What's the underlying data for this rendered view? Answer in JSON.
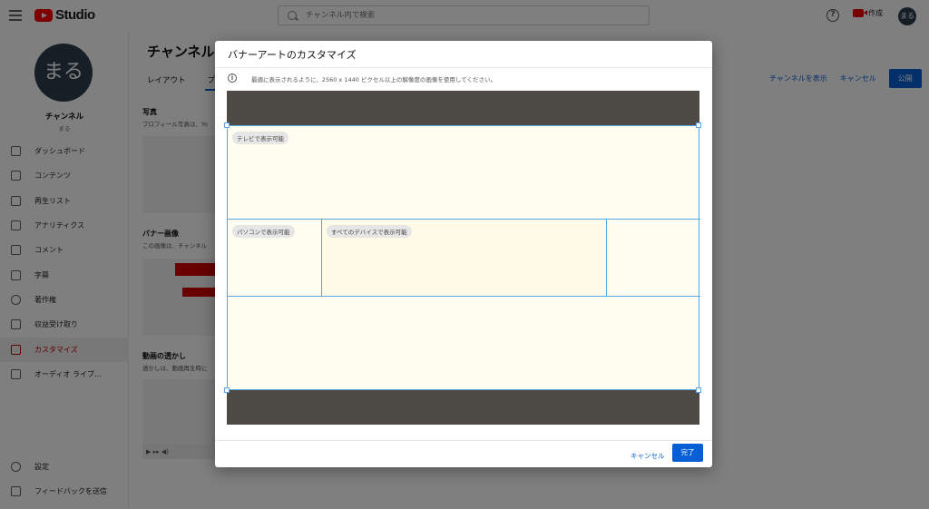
{
  "app": {
    "logo_text": "Studio"
  },
  "header": {
    "search_placeholder": "チャンネル内で検索",
    "help_symbol": "?",
    "create_label": "作成",
    "avatar_label": "まる"
  },
  "sidebar": {
    "avatar_label": "まる",
    "channel_title": "チャンネル",
    "channel_sub": "まる",
    "items": [
      {
        "label": "ダッシュボード",
        "icon": "dashboard-icon"
      },
      {
        "label": "コンテンツ",
        "icon": "content-icon"
      },
      {
        "label": "再生リスト",
        "icon": "playlist-icon"
      },
      {
        "label": "アナリティクス",
        "icon": "analytics-icon"
      },
      {
        "label": "コメント",
        "icon": "comment-icon"
      },
      {
        "label": "字幕",
        "icon": "subtitles-icon"
      },
      {
        "label": "著作権",
        "icon": "copyright-icon"
      },
      {
        "label": "収益受け取り",
        "icon": "dollar-icon"
      },
      {
        "label": "カスタマイズ",
        "icon": "magic-wand-icon",
        "active": true
      },
      {
        "label": "オーディオ ライブ...",
        "icon": "audio-library-icon"
      }
    ],
    "footer": [
      {
        "label": "設定",
        "icon": "gear-icon"
      },
      {
        "label": "フィードバックを送信",
        "icon": "feedback-icon"
      }
    ]
  },
  "main": {
    "title": "チャンネルの",
    "tabs": [
      "レイアウト",
      "プ"
    ],
    "actions": {
      "view_channel": "チャンネルを表示",
      "cancel": "キャンセル",
      "publish": "公開"
    },
    "sections": {
      "photo": {
        "label": "写真",
        "desc": "プロフィール写真は、Yo"
      },
      "banner": {
        "label": "バナー画像",
        "desc": "この画像は、チャンネル"
      },
      "watermark": {
        "label": "動画の透かし",
        "desc": "透かしは、動画再生時に"
      }
    }
  },
  "modal": {
    "title": "バナーアートのカスタマイズ",
    "info_symbol": "i",
    "info_text": "最適に表示されるように、2560 x 1440 ピクセル以上の解像度の画像を使用してください。",
    "zones": {
      "tv": "テレビで表示可能",
      "desktop": "パソコンで表示可能",
      "all_devices": "すべてのデバイスで表示可能"
    },
    "cancel_label": "キャンセル",
    "done_label": "完了"
  },
  "colors": {
    "accent": "#065fd4",
    "brand_red": "#ff0000",
    "guide_line": "#5aa6e8",
    "banner_dark": "#4e4b46",
    "safe_area": "#fffdf0"
  }
}
